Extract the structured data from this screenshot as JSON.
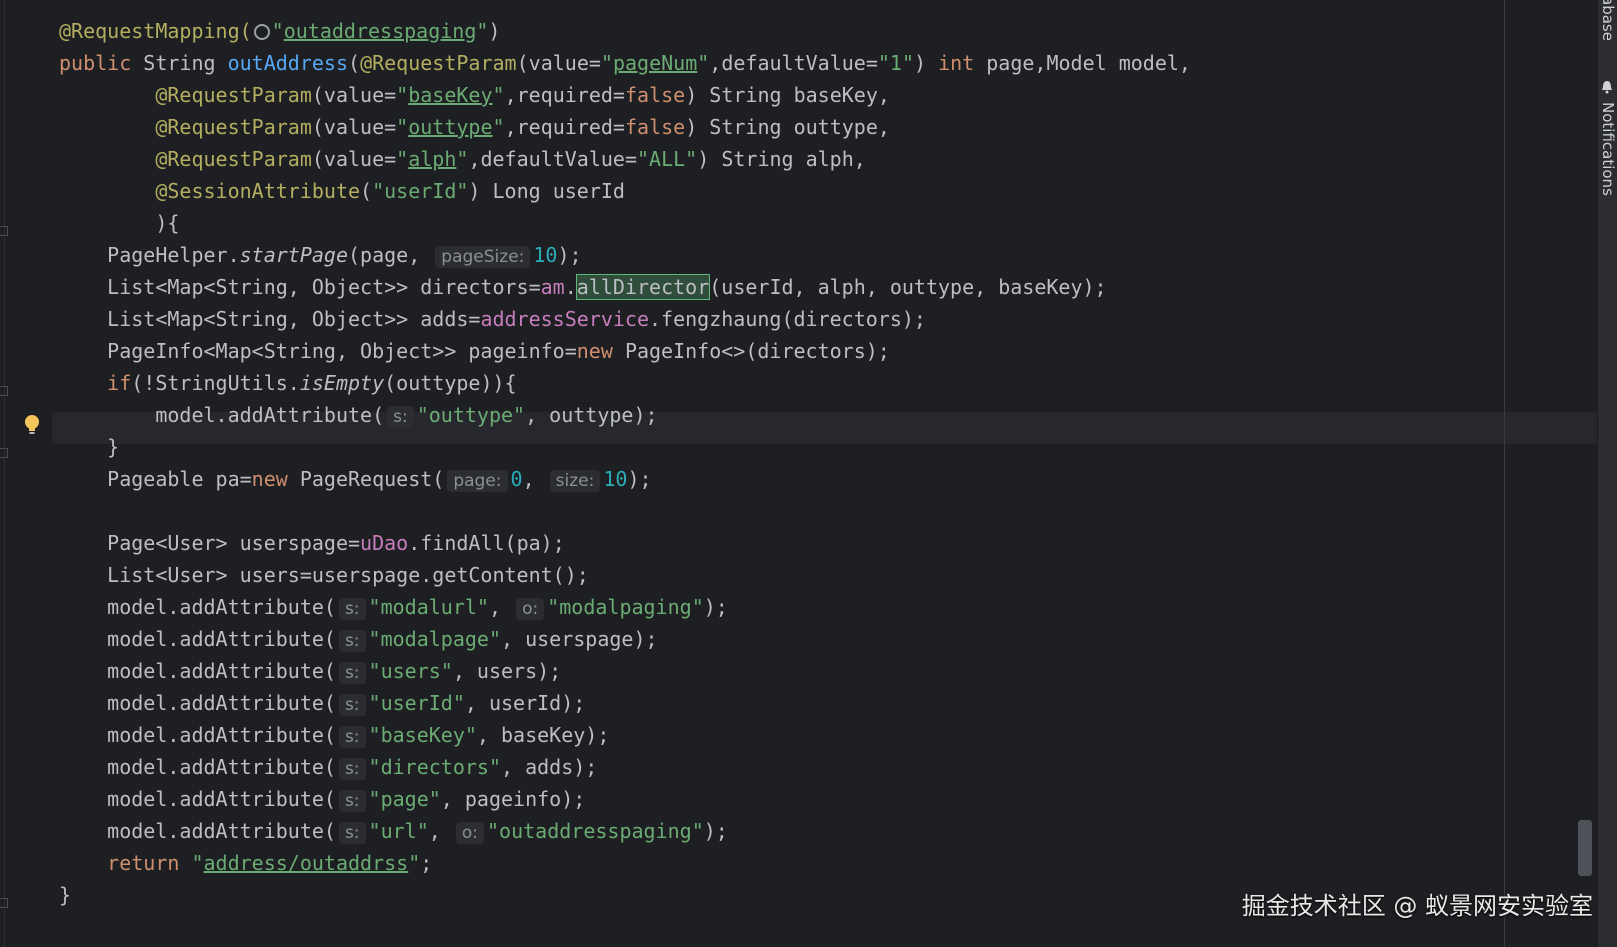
{
  "editor": {
    "lines": [
      [
        {
          "t": "@RequestMapping(",
          "c": "an"
        },
        {
          "icon": "globe-icon"
        },
        {
          "t": "\"",
          "c": "st"
        },
        {
          "t": "outaddresspaging",
          "c": "st ul"
        },
        {
          "t": "\"",
          "c": "st"
        },
        {
          "t": ")"
        }
      ],
      [
        {
          "t": "public ",
          "c": "kw"
        },
        {
          "t": "String "
        },
        {
          "t": "outAddress",
          "c": "mth"
        },
        {
          "t": "("
        },
        {
          "t": "@RequestParam",
          "c": "an"
        },
        {
          "t": "(value="
        },
        {
          "t": "\"",
          "c": "st"
        },
        {
          "t": "pageNum",
          "c": "st ul"
        },
        {
          "t": "\"",
          "c": "st"
        },
        {
          "t": ",defaultValue="
        },
        {
          "t": "\"1\"",
          "c": "st"
        },
        {
          "t": ") "
        },
        {
          "t": "int ",
          "c": "kw"
        },
        {
          "t": "page,Model model,"
        }
      ],
      [
        {
          "t": "        "
        },
        {
          "t": "@RequestParam",
          "c": "an"
        },
        {
          "t": "(value="
        },
        {
          "t": "\"",
          "c": "st"
        },
        {
          "t": "baseKey",
          "c": "st ul"
        },
        {
          "t": "\"",
          "c": "st"
        },
        {
          "t": ",required="
        },
        {
          "t": "false",
          "c": "kw"
        },
        {
          "t": ") String baseKey,"
        }
      ],
      [
        {
          "t": "        "
        },
        {
          "t": "@RequestParam",
          "c": "an"
        },
        {
          "t": "(value="
        },
        {
          "t": "\"",
          "c": "st"
        },
        {
          "t": "outtype",
          "c": "st ul"
        },
        {
          "t": "\"",
          "c": "st"
        },
        {
          "t": ",required="
        },
        {
          "t": "false",
          "c": "kw"
        },
        {
          "t": ") String outtype,"
        }
      ],
      [
        {
          "t": "        "
        },
        {
          "t": "@RequestParam",
          "c": "an"
        },
        {
          "t": "(value="
        },
        {
          "t": "\"",
          "c": "st"
        },
        {
          "t": "alph",
          "c": "st ul"
        },
        {
          "t": "\"",
          "c": "st"
        },
        {
          "t": ",defaultValue="
        },
        {
          "t": "\"ALL\"",
          "c": "st"
        },
        {
          "t": ") String alph,"
        }
      ],
      [
        {
          "t": "        "
        },
        {
          "t": "@SessionAttribute",
          "c": "an"
        },
        {
          "t": "("
        },
        {
          "t": "\"userId\"",
          "c": "st"
        },
        {
          "t": ") Long userId"
        }
      ],
      [
        {
          "t": "        ){"
        }
      ],
      [
        {
          "t": "    PageHelper."
        },
        {
          "t": "startPage",
          "c": "it"
        },
        {
          "t": "(page, "
        },
        {
          "hint": "pageSize:"
        },
        {
          "t": "10",
          "c": "nm"
        },
        {
          "t": ");"
        }
      ],
      [
        {
          "t": "    List<Map<String, Object>> directors="
        },
        {
          "t": "am",
          "c": "fld"
        },
        {
          "t": "."
        },
        {
          "t": "allDirector",
          "c": "hl"
        },
        {
          "t": "(userId, alph, outtype, baseKey);"
        }
      ],
      [
        {
          "t": "    List<Map<String, Object>> adds="
        },
        {
          "t": "addressService",
          "c": "fld"
        },
        {
          "t": ".fengzhaung(directors);"
        }
      ],
      [
        {
          "t": "    PageInfo<Map<String, Object>> pageinfo="
        },
        {
          "t": "new ",
          "c": "kw"
        },
        {
          "t": "PageInfo<>(directors);"
        }
      ],
      [
        {
          "t": "    "
        },
        {
          "t": "if",
          "c": "kw"
        },
        {
          "t": "(!StringUtils."
        },
        {
          "t": "isEmpty",
          "c": "it"
        },
        {
          "t": "(outtype)){"
        }
      ],
      [
        {
          "t": "        model.addAttribute("
        },
        {
          "hint": "s:"
        },
        {
          "t": "\"outtype\"",
          "c": "st"
        },
        {
          "t": ", outtype);"
        }
      ],
      [
        {
          "t": "    }"
        }
      ],
      [
        {
          "t": "    Pageable pa="
        },
        {
          "t": "new ",
          "c": "kw"
        },
        {
          "t": "PageRequest("
        },
        {
          "hint": "page:"
        },
        {
          "t": "0",
          "c": "nm"
        },
        {
          "t": ", "
        },
        {
          "hint": "size:"
        },
        {
          "t": "10",
          "c": "nm"
        },
        {
          "t": ");"
        }
      ],
      [],
      [
        {
          "t": "    Page<User> userspage="
        },
        {
          "t": "uDao",
          "c": "fld"
        },
        {
          "t": ".findAll(pa);"
        }
      ],
      [
        {
          "t": "    List<User> users=userspage.getContent();"
        }
      ],
      [
        {
          "t": "    model.addAttribute("
        },
        {
          "hint": "s:"
        },
        {
          "t": "\"modalurl\"",
          "c": "st"
        },
        {
          "t": ", "
        },
        {
          "hint": "o:"
        },
        {
          "t": "\"modalpaging\"",
          "c": "st"
        },
        {
          "t": ");"
        }
      ],
      [
        {
          "t": "    model.addAttribute("
        },
        {
          "hint": "s:"
        },
        {
          "t": "\"modalpage\"",
          "c": "st"
        },
        {
          "t": ", userspage);"
        }
      ],
      [
        {
          "t": "    model.addAttribute("
        },
        {
          "hint": "s:"
        },
        {
          "t": "\"users\"",
          "c": "st"
        },
        {
          "t": ", users);"
        }
      ],
      [
        {
          "t": "    model.addAttribute("
        },
        {
          "hint": "s:"
        },
        {
          "t": "\"userId\"",
          "c": "st"
        },
        {
          "t": ", userId);"
        }
      ],
      [
        {
          "t": "    model.addAttribute("
        },
        {
          "hint": "s:"
        },
        {
          "t": "\"baseKey\"",
          "c": "st"
        },
        {
          "t": ", baseKey);"
        }
      ],
      [
        {
          "t": "    model.addAttribute("
        },
        {
          "hint": "s:"
        },
        {
          "t": "\"directors\"",
          "c": "st"
        },
        {
          "t": ", adds);"
        }
      ],
      [
        {
          "t": "    model.addAttribute("
        },
        {
          "hint": "s:"
        },
        {
          "t": "\"page\"",
          "c": "st"
        },
        {
          "t": ", pageinfo);"
        }
      ],
      [
        {
          "t": "    model.addAttribute("
        },
        {
          "hint": "s:"
        },
        {
          "t": "\"url\"",
          "c": "st"
        },
        {
          "t": ", "
        },
        {
          "hint": "o:"
        },
        {
          "t": "\"outaddresspaging\"",
          "c": "st"
        },
        {
          "t": ");"
        }
      ],
      [
        {
          "t": "    "
        },
        {
          "t": "return ",
          "c": "kw"
        },
        {
          "t": "\"",
          "c": "st"
        },
        {
          "t": "address/outaddrss",
          "c": "st ul"
        },
        {
          "t": "\"",
          "c": "st"
        },
        {
          "t": ";"
        }
      ],
      [
        {
          "t": "}"
        }
      ]
    ]
  },
  "sidebar": {
    "database_label": "abase",
    "notifications_label": "Notifications"
  },
  "watermark": "掘金技术社区 @ 蚁景网安实验室",
  "colors": {
    "background": "#1e1f22",
    "keyword": "#cf8e6d",
    "annotation": "#b3ae60",
    "string": "#6aab73",
    "number": "#2aacb8",
    "field": "#c77dbb",
    "method": "#56a8f5"
  }
}
